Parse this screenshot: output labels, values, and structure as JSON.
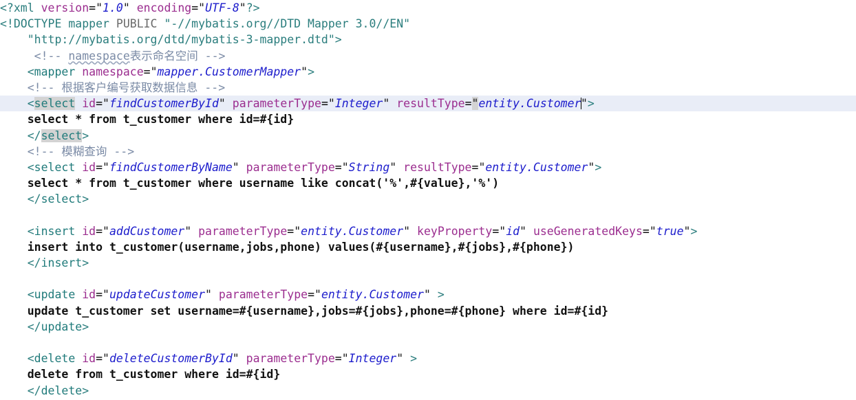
{
  "editor": {
    "language": "XML",
    "file_kind": "MyBatis mapper XML",
    "colors": {
      "background": "#ffffff",
      "current_line_highlight": "#e9edf7",
      "matched_tag_highlight": "#d3d3d3",
      "tag_name": "#1f7a7a",
      "attribute_name": "#9b2d8f",
      "attribute_value": "#1c1ccc",
      "comment": "#7b8ba6",
      "text_content": "#111111",
      "caret": "#000000"
    },
    "caret": {
      "line_index": 7,
      "after_text": "entity.Customer"
    },
    "current_line_index": 7,
    "matched_tag_name": "select"
  },
  "lines": [
    {
      "n": 1,
      "indent": 0,
      "tokens": [
        {
          "t": "pi",
          "s": "<?xml "
        },
        {
          "t": "attr",
          "s": "version"
        },
        {
          "t": "dark",
          "s": "="
        },
        {
          "t": "quote",
          "s": "\""
        },
        {
          "t": "val",
          "s": "1.0"
        },
        {
          "t": "quote",
          "s": "\""
        },
        {
          "t": "dark",
          "s": " "
        },
        {
          "t": "attr",
          "s": "encoding"
        },
        {
          "t": "dark",
          "s": "="
        },
        {
          "t": "quote",
          "s": "\""
        },
        {
          "t": "val",
          "s": "UTF-8"
        },
        {
          "t": "quote",
          "s": "\""
        },
        {
          "t": "pi",
          "s": "?>"
        }
      ]
    },
    {
      "n": 2,
      "indent": 0,
      "tokens": [
        {
          "t": "doctype-kw",
          "s": "<!DOCTYPE mapper "
        },
        {
          "t": "doctype-pub",
          "s": "PUBLIC "
        },
        {
          "t": "doctype-str",
          "s": "\"-//mybatis.org//DTD Mapper 3.0//EN\""
        }
      ]
    },
    {
      "n": 3,
      "indent": 0,
      "tokens": [
        {
          "t": "doctype-str",
          "s": "    \"http://mybatis.org/dtd/mybatis-3-mapper.dtd\""
        },
        {
          "t": "doctype-kw",
          "s": ">"
        }
      ]
    },
    {
      "n": 4,
      "indent": 0,
      "tokens": [
        {
          "t": "comment",
          "s": "     <!-- "
        },
        {
          "t": "comment-sq",
          "s": "namespace"
        },
        {
          "t": "comment",
          "s": "表示命名空间 -->"
        }
      ]
    },
    {
      "n": 5,
      "indent": 0,
      "tokens": [
        {
          "t": "punct",
          "s": "    <"
        },
        {
          "t": "tagname",
          "s": "mapper"
        },
        {
          "t": "dark",
          "s": " "
        },
        {
          "t": "attr",
          "s": "namespace"
        },
        {
          "t": "dark",
          "s": "="
        },
        {
          "t": "quote",
          "s": "\""
        },
        {
          "t": "val",
          "s": "mapper.CustomerMapper"
        },
        {
          "t": "quote",
          "s": "\""
        },
        {
          "t": "punct",
          "s": ">"
        }
      ]
    },
    {
      "n": 6,
      "indent": 0,
      "tokens": [
        {
          "t": "comment",
          "s": "    <!-- 根据客户编号获取数据信息 -->"
        }
      ]
    },
    {
      "n": 7,
      "indent": 0,
      "current": true,
      "tokens": [
        {
          "t": "punct",
          "s": "    <"
        },
        {
          "t": "tagname-matched",
          "s": "select"
        },
        {
          "t": "dark",
          "s": " "
        },
        {
          "t": "attr",
          "s": "id"
        },
        {
          "t": "dark",
          "s": "="
        },
        {
          "t": "quote",
          "s": "\""
        },
        {
          "t": "val",
          "s": "findCustomerById"
        },
        {
          "t": "quote",
          "s": "\""
        },
        {
          "t": "dark",
          "s": " "
        },
        {
          "t": "attr",
          "s": "parameterType"
        },
        {
          "t": "dark",
          "s": "="
        },
        {
          "t": "quote",
          "s": "\""
        },
        {
          "t": "val",
          "s": "Integer"
        },
        {
          "t": "quote",
          "s": "\""
        },
        {
          "t": "dark",
          "s": " "
        },
        {
          "t": "attr",
          "s": "resultType"
        },
        {
          "t": "dark",
          "s": "="
        },
        {
          "t": "quote-sel",
          "s": "\""
        },
        {
          "t": "val",
          "s": "entity.Customer"
        },
        {
          "t": "caret",
          "s": ""
        },
        {
          "t": "quote",
          "s": "\""
        },
        {
          "t": "punct",
          "s": ">"
        }
      ]
    },
    {
      "n": 8,
      "indent": 0,
      "tokens": [
        {
          "t": "text",
          "s": "    select * from t_customer where id=#{id}"
        }
      ]
    },
    {
      "n": 9,
      "indent": 0,
      "tokens": [
        {
          "t": "punct",
          "s": "    </"
        },
        {
          "t": "tagname-matched",
          "s": "select"
        },
        {
          "t": "punct",
          "s": ">"
        }
      ]
    },
    {
      "n": 10,
      "indent": 0,
      "tokens": [
        {
          "t": "comment",
          "s": "    <!-- 模糊查询 -->"
        }
      ]
    },
    {
      "n": 11,
      "indent": 0,
      "tokens": [
        {
          "t": "punct",
          "s": "    <"
        },
        {
          "t": "tagname",
          "s": "select"
        },
        {
          "t": "dark",
          "s": " "
        },
        {
          "t": "attr",
          "s": "id"
        },
        {
          "t": "dark",
          "s": "="
        },
        {
          "t": "quote",
          "s": "\""
        },
        {
          "t": "val",
          "s": "findCustomerByName"
        },
        {
          "t": "quote",
          "s": "\""
        },
        {
          "t": "dark",
          "s": " "
        },
        {
          "t": "attr",
          "s": "parameterType"
        },
        {
          "t": "dark",
          "s": "="
        },
        {
          "t": "quote",
          "s": "\""
        },
        {
          "t": "val",
          "s": "String"
        },
        {
          "t": "quote",
          "s": "\""
        },
        {
          "t": "dark",
          "s": " "
        },
        {
          "t": "attr",
          "s": "resultType"
        },
        {
          "t": "dark",
          "s": "="
        },
        {
          "t": "quote",
          "s": "\""
        },
        {
          "t": "val",
          "s": "entity.Customer"
        },
        {
          "t": "quote",
          "s": "\""
        },
        {
          "t": "punct",
          "s": ">"
        }
      ]
    },
    {
      "n": 12,
      "indent": 0,
      "tokens": [
        {
          "t": "text",
          "s": "    select * from t_customer where username like concat('%',#{value},'%')"
        }
      ]
    },
    {
      "n": 13,
      "indent": 0,
      "tokens": [
        {
          "t": "punct",
          "s": "    </"
        },
        {
          "t": "tagname",
          "s": "select"
        },
        {
          "t": "punct",
          "s": ">"
        }
      ]
    },
    {
      "n": 14,
      "indent": 0,
      "tokens": []
    },
    {
      "n": 15,
      "indent": 0,
      "tokens": [
        {
          "t": "punct",
          "s": "    <"
        },
        {
          "t": "tagname",
          "s": "insert"
        },
        {
          "t": "dark",
          "s": " "
        },
        {
          "t": "attr",
          "s": "id"
        },
        {
          "t": "dark",
          "s": "="
        },
        {
          "t": "quote",
          "s": "\""
        },
        {
          "t": "val",
          "s": "addCustomer"
        },
        {
          "t": "quote",
          "s": "\""
        },
        {
          "t": "dark",
          "s": " "
        },
        {
          "t": "attr",
          "s": "parameterType"
        },
        {
          "t": "dark",
          "s": "="
        },
        {
          "t": "quote",
          "s": "\""
        },
        {
          "t": "val",
          "s": "entity.Customer"
        },
        {
          "t": "quote",
          "s": "\""
        },
        {
          "t": "dark",
          "s": " "
        },
        {
          "t": "attr",
          "s": "keyProperty"
        },
        {
          "t": "dark",
          "s": "="
        },
        {
          "t": "quote",
          "s": "\""
        },
        {
          "t": "val",
          "s": "id"
        },
        {
          "t": "quote",
          "s": "\""
        },
        {
          "t": "dark",
          "s": " "
        },
        {
          "t": "attr",
          "s": "useGeneratedKeys"
        },
        {
          "t": "dark",
          "s": "="
        },
        {
          "t": "quote",
          "s": "\""
        },
        {
          "t": "val",
          "s": "true"
        },
        {
          "t": "quote",
          "s": "\""
        },
        {
          "t": "punct",
          "s": ">"
        }
      ]
    },
    {
      "n": 16,
      "indent": 0,
      "tokens": [
        {
          "t": "text",
          "s": "    insert into t_customer(username,jobs,phone) values(#{username},#{jobs},#{phone})"
        }
      ]
    },
    {
      "n": 17,
      "indent": 0,
      "tokens": [
        {
          "t": "punct",
          "s": "    </"
        },
        {
          "t": "tagname",
          "s": "insert"
        },
        {
          "t": "punct",
          "s": ">"
        }
      ]
    },
    {
      "n": 18,
      "indent": 0,
      "tokens": []
    },
    {
      "n": 19,
      "indent": 0,
      "tokens": [
        {
          "t": "punct",
          "s": "    <"
        },
        {
          "t": "tagname",
          "s": "update"
        },
        {
          "t": "dark",
          "s": " "
        },
        {
          "t": "attr",
          "s": "id"
        },
        {
          "t": "dark",
          "s": "="
        },
        {
          "t": "quote",
          "s": "\""
        },
        {
          "t": "val",
          "s": "updateCustomer"
        },
        {
          "t": "quote",
          "s": "\""
        },
        {
          "t": "dark",
          "s": " "
        },
        {
          "t": "attr",
          "s": "parameterType"
        },
        {
          "t": "dark",
          "s": "="
        },
        {
          "t": "quote",
          "s": "\""
        },
        {
          "t": "val",
          "s": "entity.Customer"
        },
        {
          "t": "quote",
          "s": "\""
        },
        {
          "t": "punct",
          "s": " >"
        }
      ]
    },
    {
      "n": 20,
      "indent": 0,
      "tokens": [
        {
          "t": "text",
          "s": "    update t_customer set username=#{username},jobs=#{jobs},phone=#{phone} where id=#{id}"
        }
      ]
    },
    {
      "n": 21,
      "indent": 0,
      "tokens": [
        {
          "t": "punct",
          "s": "    </"
        },
        {
          "t": "tagname",
          "s": "update"
        },
        {
          "t": "punct",
          "s": ">"
        }
      ]
    },
    {
      "n": 22,
      "indent": 0,
      "tokens": []
    },
    {
      "n": 23,
      "indent": 0,
      "tokens": [
        {
          "t": "punct",
          "s": "    <"
        },
        {
          "t": "tagname",
          "s": "delete"
        },
        {
          "t": "dark",
          "s": " "
        },
        {
          "t": "attr",
          "s": "id"
        },
        {
          "t": "dark",
          "s": "="
        },
        {
          "t": "quote",
          "s": "\""
        },
        {
          "t": "val",
          "s": "deleteCustomerById"
        },
        {
          "t": "quote",
          "s": "\""
        },
        {
          "t": "dark",
          "s": " "
        },
        {
          "t": "attr",
          "s": "parameterType"
        },
        {
          "t": "dark",
          "s": "="
        },
        {
          "t": "quote",
          "s": "\""
        },
        {
          "t": "val",
          "s": "Integer"
        },
        {
          "t": "quote",
          "s": "\""
        },
        {
          "t": "punct",
          "s": " >"
        }
      ]
    },
    {
      "n": 24,
      "indent": 0,
      "tokens": [
        {
          "t": "text",
          "s": "    delete from t_customer where id=#{id}"
        }
      ]
    },
    {
      "n": 25,
      "indent": 0,
      "tokens": [
        {
          "t": "punct",
          "s": "    </"
        },
        {
          "t": "tagname",
          "s": "delete"
        },
        {
          "t": "punct",
          "s": ">"
        }
      ]
    }
  ]
}
